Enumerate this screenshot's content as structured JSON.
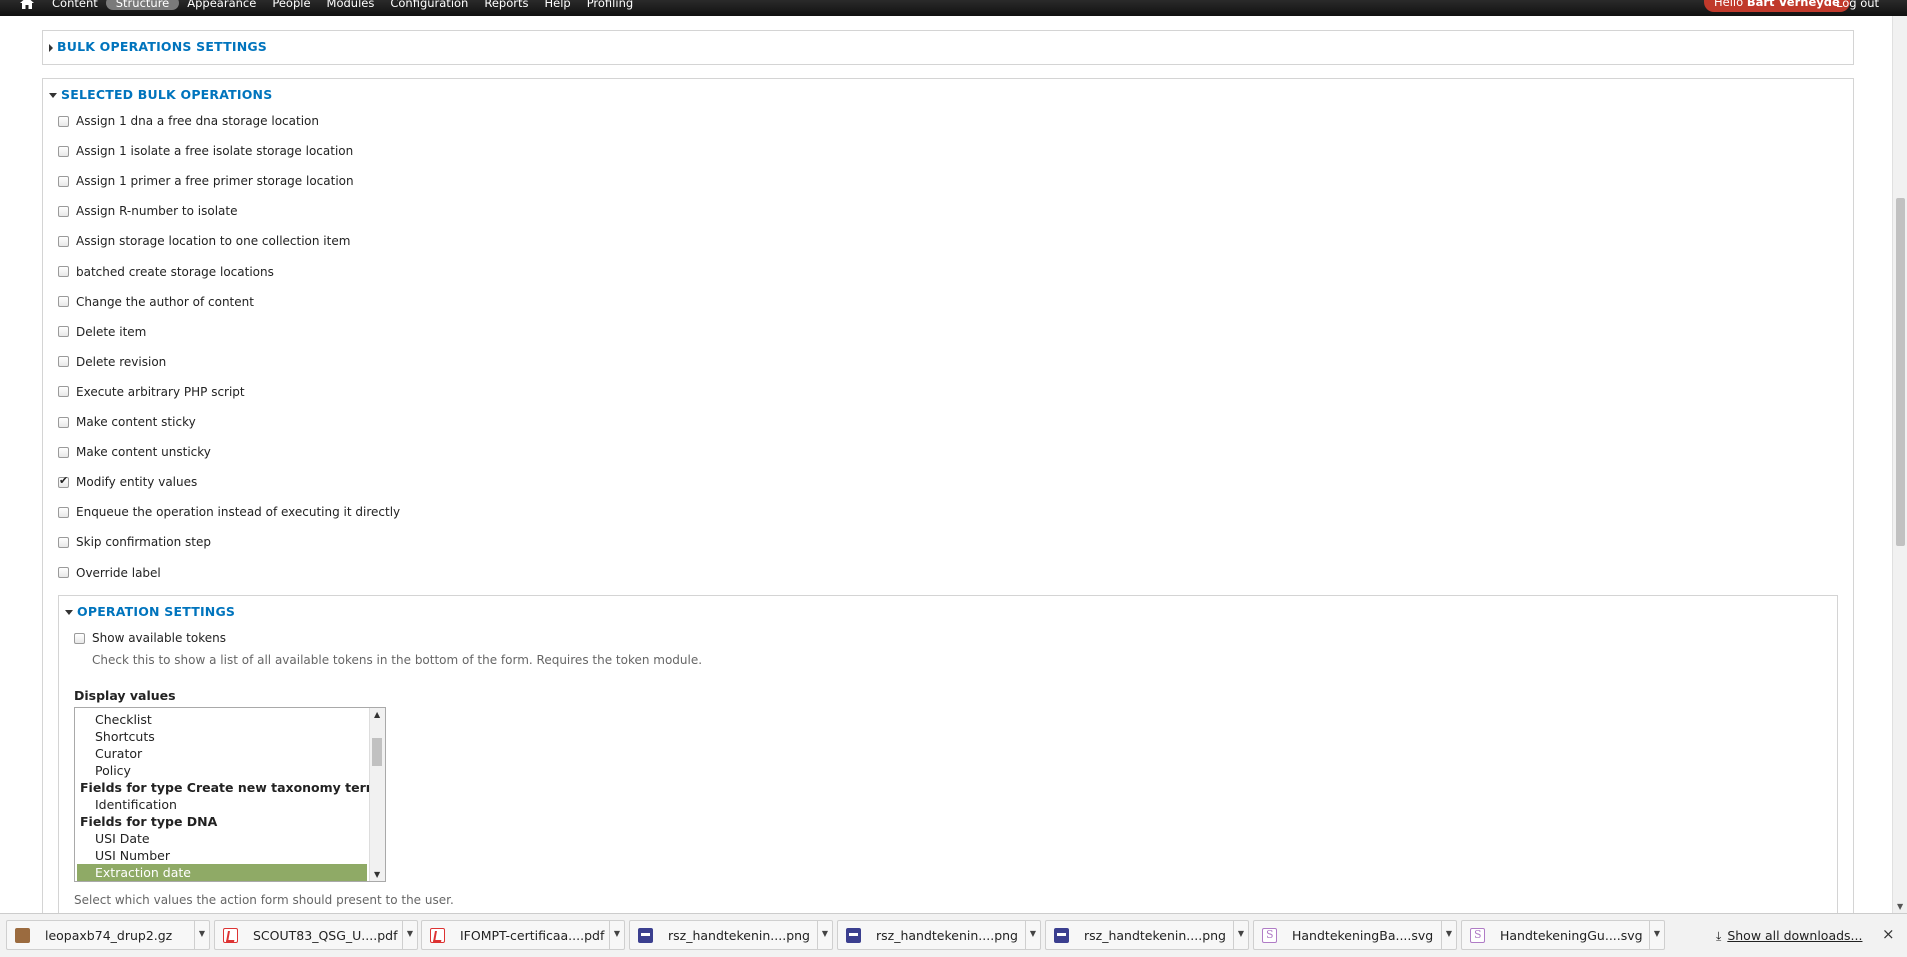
{
  "toolbar": {
    "nav": [
      "Content",
      "Structure",
      "Appearance",
      "People",
      "Modules",
      "Configuration",
      "Reports",
      "Help",
      "Profiling"
    ],
    "active_index": 1,
    "hello_prefix": "Hello ",
    "user_name": "Bart Verheyde",
    "logout": "Log out"
  },
  "bulk_settings": {
    "legend": "BULK OPERATIONS SETTINGS"
  },
  "selected_ops": {
    "legend": "SELECTED BULK OPERATIONS",
    "items": [
      {
        "label": "Assign 1 dna a free dna storage location",
        "checked": false
      },
      {
        "label": "Assign 1 isolate a free isolate storage location",
        "checked": false
      },
      {
        "label": "Assign 1 primer a free primer storage location",
        "checked": false
      },
      {
        "label": "Assign R-number to isolate",
        "checked": false
      },
      {
        "label": "Assign storage location to one collection item",
        "checked": false
      },
      {
        "label": "batched create storage locations",
        "checked": false
      },
      {
        "label": "Change the author of content",
        "checked": false
      },
      {
        "label": "Delete item",
        "checked": false
      },
      {
        "label": "Delete revision",
        "checked": false
      },
      {
        "label": "Execute arbitrary PHP script",
        "checked": false
      },
      {
        "label": "Make content sticky",
        "checked": false
      },
      {
        "label": "Make content unsticky",
        "checked": false
      },
      {
        "label": "Modify entity values",
        "checked": true
      },
      {
        "label": "Enqueue the operation instead of executing it directly",
        "checked": false
      },
      {
        "label": "Skip confirmation step",
        "checked": false
      },
      {
        "label": "Override label",
        "checked": false
      }
    ]
  },
  "operation_settings": {
    "legend": "OPERATION SETTINGS",
    "show_tokens_label": "Show available tokens",
    "show_tokens_checked": false,
    "show_tokens_desc": "Check this to show a list of all available tokens in the bottom of the form. Requires the token module.",
    "display_values_label": "Display values",
    "display_values_options": [
      {
        "label": "Checklist",
        "kind": "child",
        "selected": false
      },
      {
        "label": "Shortcuts",
        "kind": "child",
        "selected": false
      },
      {
        "label": "Curator",
        "kind": "child",
        "selected": false
      },
      {
        "label": "Policy",
        "kind": "child",
        "selected": false
      },
      {
        "label": "Fields for type Create new taxonomy term",
        "kind": "group",
        "selected": false
      },
      {
        "label": "Identification",
        "kind": "child",
        "selected": false
      },
      {
        "label": "Fields for type DNA",
        "kind": "group",
        "selected": false
      },
      {
        "label": "USI Date",
        "kind": "child",
        "selected": false
      },
      {
        "label": "USI Number",
        "kind": "child",
        "selected": false
      },
      {
        "label": "Extraction date",
        "kind": "child",
        "selected": true
      }
    ],
    "display_values_desc": "Select which values the action form should present to the user."
  },
  "downloads": {
    "items": [
      {
        "name": "leopaxb74_drup2.gz",
        "icon": "package-icon"
      },
      {
        "name": "SCOUT83_QSG_U....pdf",
        "icon": "pdf-icon"
      },
      {
        "name": "IFOMPT-certificaa....pdf",
        "icon": "pdf-icon"
      },
      {
        "name": "rsz_handtekenin....png",
        "icon": "image-icon"
      },
      {
        "name": "rsz_handtekenin....png",
        "icon": "image-icon"
      },
      {
        "name": "rsz_handtekenin....png",
        "icon": "image-icon"
      },
      {
        "name": "HandtekeningBa....svg",
        "icon": "svg-icon"
      },
      {
        "name": "HandtekeningGu....svg",
        "icon": "svg-icon"
      }
    ],
    "show_all": "Show all downloads...",
    "close_glyph": "×"
  },
  "colors": {
    "link": "#0074bd",
    "selected_option": "#8faa66",
    "user_badge": "#c0392b"
  }
}
